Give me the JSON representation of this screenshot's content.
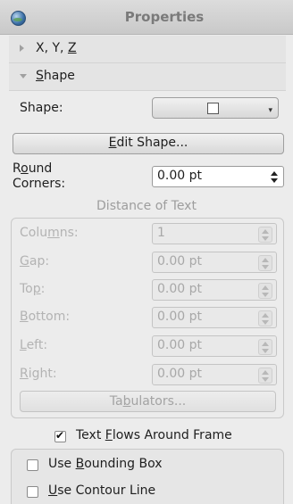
{
  "title": "Properties",
  "sections": [
    {
      "label": "X, Y, Z",
      "expanded": false
    },
    {
      "label": "Shape",
      "expanded": true
    }
  ],
  "shape": {
    "label": "Shape:",
    "edit_button": "Edit Shape...",
    "round_corners_label_1": "Round",
    "round_corners_label_2": "Corners:",
    "round_corners_value": "0.00 pt"
  },
  "distance": {
    "title": "Distance of Text",
    "columns_label": "Columns:",
    "columns_value": "1",
    "gap_label": "Gap:",
    "gap_value": "0.00 pt",
    "top_label": "Top:",
    "top_value": "0.00 pt",
    "bottom_label": "Bottom:",
    "bottom_value": "0.00 pt",
    "left_label": "Left:",
    "left_value": "0.00 pt",
    "right_label": "Right:",
    "right_value": "0.00 pt",
    "tabulators_button": "Tabulators..."
  },
  "text_flow": {
    "label": "Text Flows Around Frame",
    "checked": true,
    "use_bounding_box": "Use Bounding Box",
    "use_bounding_box_checked": false,
    "use_contour_line": "Use Contour Line",
    "use_contour_line_checked": false
  }
}
